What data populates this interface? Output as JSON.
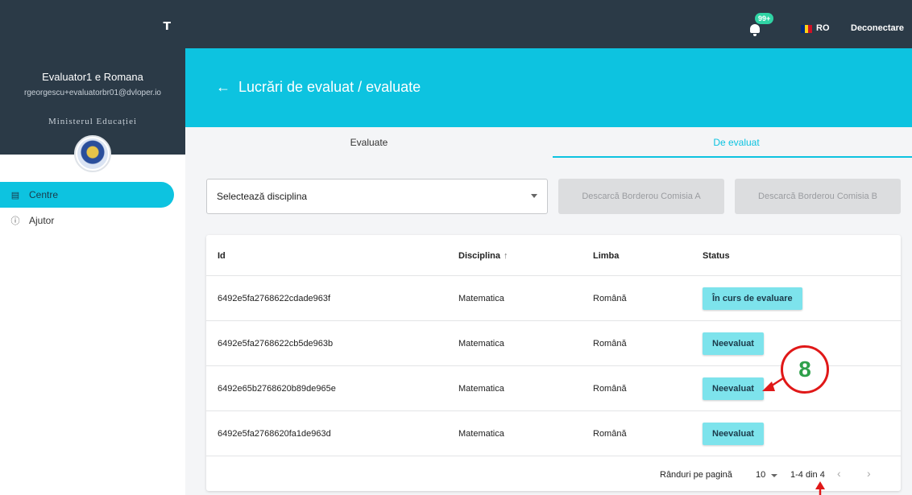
{
  "sidebar": {
    "pin_icon": "↕",
    "user_name": "Evaluator1 e Romana",
    "user_email": "rgeorgescu+evaluatorbr01@dvloper.io",
    "ministry": "Ministerul Educației",
    "items": [
      {
        "label": "Centre",
        "icon": "clipboard-icon",
        "active": true
      },
      {
        "label": "Ajutor",
        "icon": "help-icon",
        "active": false
      }
    ]
  },
  "topbar": {
    "notifications_badge": "99+",
    "language": "RO",
    "logout": "Deconectare",
    "flag_colors": [
      "#002b7f",
      "#fcd116",
      "#ce1126"
    ]
  },
  "header": {
    "back_arrow": "←",
    "title": "Lucrări de evaluat / evaluate"
  },
  "tabs": [
    {
      "label": "Evaluate",
      "active": false
    },
    {
      "label": "De evaluat",
      "active": true
    }
  ],
  "filters": {
    "discipline_select": "Selectează disciplina",
    "btn_commission_a": "Descarcă Borderou Comisia A",
    "btn_commission_b": "Descarcă Borderou Comisia B"
  },
  "table": {
    "columns": [
      "Id",
      "Disciplina",
      "Limba",
      "Status"
    ],
    "sort_indicator": "↑",
    "rows": [
      {
        "id": "6492e5fa2768622cdade963f",
        "discipline": "Matematica",
        "language": "Română",
        "status": "În curs de evaluare"
      },
      {
        "id": "6492e5fa2768622cb5de963b",
        "discipline": "Matematica",
        "language": "Română",
        "status": "Neevaluat"
      },
      {
        "id": "6492e65b2768620b89de965e",
        "discipline": "Matematica",
        "language": "Română",
        "status": "Neevaluat"
      },
      {
        "id": "6492e5fa2768620fa1de963d",
        "discipline": "Matematica",
        "language": "Română",
        "status": "Neevaluat"
      }
    ]
  },
  "pagination": {
    "rows_per_page_label": "Rânduri pe pagină",
    "rows_per_page": "10",
    "range": "1-4 din 4",
    "prev": "‹",
    "next": "›"
  },
  "annotation": {
    "step_number": "8"
  },
  "colors": {
    "accent": "#0dc3e0",
    "dark": "#2b3a47",
    "status_bg": "#7de3ec",
    "annotation_red": "#e01818",
    "annotation_green": "#2ea04a"
  }
}
